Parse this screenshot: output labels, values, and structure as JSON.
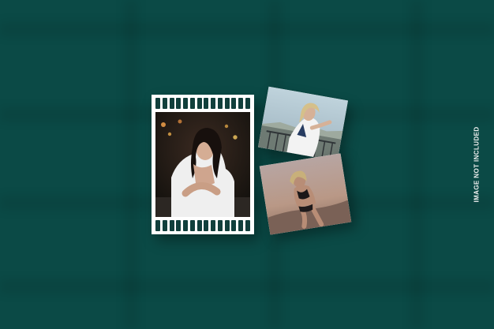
{
  "scene": {
    "background_color": "#0b4a46",
    "frame_color": "#ffffff",
    "perforation_color": "#113f3c",
    "perforation_count": 14
  },
  "side_note": {
    "text": "IMAGE NOT INCLUDED"
  }
}
